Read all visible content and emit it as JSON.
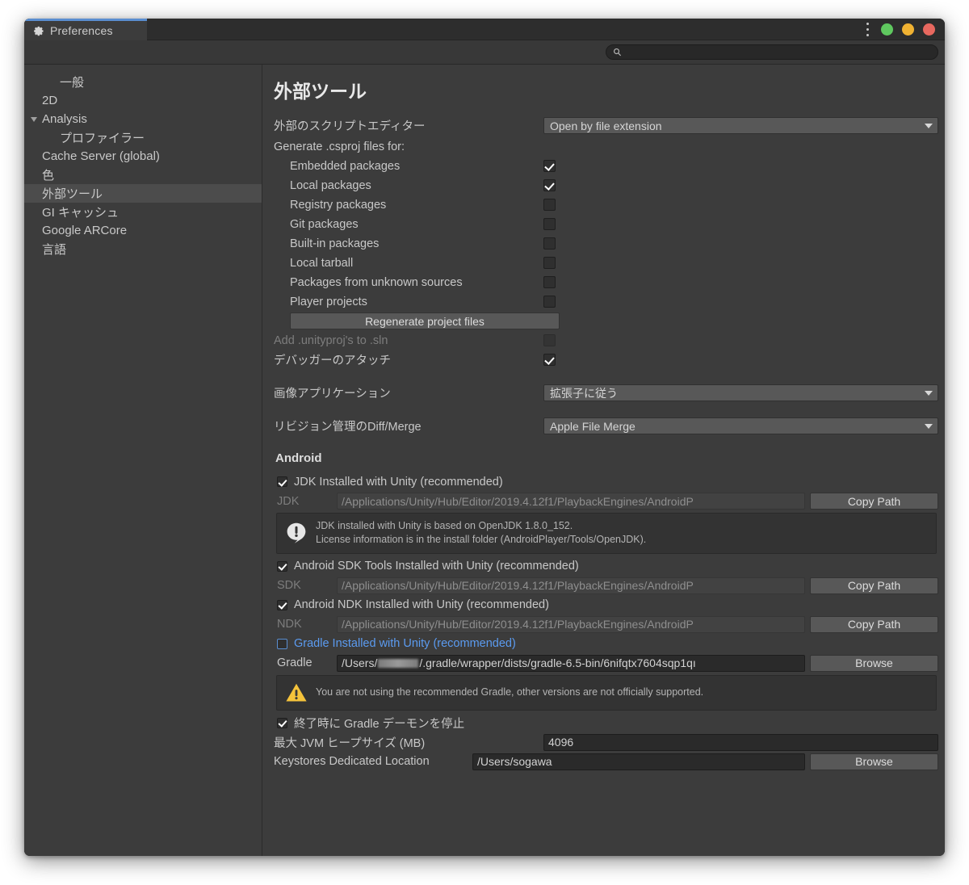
{
  "window": {
    "tab_label": "Preferences",
    "tab_icon": "gear-icon",
    "menu_icon": "kebab-menu-icon",
    "controls": [
      {
        "name": "maximize",
        "color": "#5fc85f"
      },
      {
        "name": "minimize",
        "color": "#f0b232"
      },
      {
        "name": "close",
        "color": "#e8685f"
      }
    ]
  },
  "search": {
    "value": "",
    "placeholder": "",
    "icon": "search-icon"
  },
  "sidebar": {
    "items": [
      {
        "label": "一般",
        "indent": true,
        "selected": false,
        "arrow": ""
      },
      {
        "label": "2D",
        "indent": false,
        "selected": false,
        "arrow": ""
      },
      {
        "label": "Analysis",
        "indent": false,
        "selected": false,
        "arrow": "open"
      },
      {
        "label": "プロファイラー",
        "indent": true,
        "selected": false,
        "arrow": ""
      },
      {
        "label": "Cache Server (global)",
        "indent": false,
        "selected": false,
        "arrow": ""
      },
      {
        "label": "色",
        "indent": false,
        "selected": false,
        "arrow": ""
      },
      {
        "label": "外部ツール",
        "indent": false,
        "selected": true,
        "arrow": ""
      },
      {
        "label": "GI キャッシュ",
        "indent": false,
        "selected": false,
        "arrow": ""
      },
      {
        "label": "Google ARCore",
        "indent": false,
        "selected": false,
        "arrow": ""
      },
      {
        "label": "言語",
        "indent": false,
        "selected": false,
        "arrow": ""
      }
    ]
  },
  "main": {
    "title": "外部ツール",
    "script_editor": {
      "label": "外部のスクリプトエディター",
      "value": "Open by file extension"
    },
    "csproj_label": "Generate .csproj files for:",
    "csproj_options": [
      {
        "label": "Embedded packages",
        "checked": true
      },
      {
        "label": "Local packages",
        "checked": true
      },
      {
        "label": "Registry packages",
        "checked": false
      },
      {
        "label": "Git packages",
        "checked": false
      },
      {
        "label": "Built-in packages",
        "checked": false
      },
      {
        "label": "Local tarball",
        "checked": false
      },
      {
        "label": "Packages from unknown sources",
        "checked": false
      },
      {
        "label": "Player projects",
        "checked": false
      }
    ],
    "regenerate_button": "Regenerate project files",
    "add_unityproj": {
      "label": "Add .unityproj's to .sln",
      "checked": false,
      "disabled": true
    },
    "attach_debugger": {
      "label": "デバッガーのアタッチ",
      "checked": true
    },
    "image_app": {
      "label": "画像アプリケーション",
      "value": "拡張子に従う"
    },
    "diff_merge": {
      "label": "リビジョン管理のDiff/Merge",
      "value": "Apple File Merge"
    },
    "android": {
      "heading": "Android",
      "jdk_checkbox": {
        "label": "JDK Installed with Unity (recommended)",
        "checked": true
      },
      "jdk_path": {
        "label": "JDK",
        "value": "/Applications/Unity/Hub/Editor/2019.4.12f1/PlaybackEngines/AndroidP",
        "button": "Copy Path"
      },
      "jdk_note": {
        "icon": "info-icon",
        "line1": "JDK installed with Unity is based on OpenJDK 1.8.0_152.",
        "line2": "License information is in the install folder (AndroidPlayer/Tools/OpenJDK)."
      },
      "sdk_checkbox": {
        "label": "Android SDK Tools Installed with Unity (recommended)",
        "checked": true
      },
      "sdk_path": {
        "label": "SDK",
        "value": "/Applications/Unity/Hub/Editor/2019.4.12f1/PlaybackEngines/AndroidP",
        "button": "Copy Path"
      },
      "ndk_checkbox": {
        "label": "Android NDK Installed with Unity (recommended)",
        "checked": true
      },
      "ndk_path": {
        "label": "NDK",
        "value": "/Applications/Unity/Hub/Editor/2019.4.12f1/PlaybackEngines/AndroidP",
        "button": "Copy Path"
      },
      "gradle_checkbox": {
        "label": "Gradle Installed with Unity (recommended)",
        "checked": false,
        "highlight_color": "#5b9bf0"
      },
      "gradle_path": {
        "label": "Gradle",
        "value_prefix": "/Users/",
        "value_suffix": "/.gradle/wrapper/dists/gradle-6.5-bin/6nifqtx7604sqp1qı",
        "redacted": true,
        "button": "Browse"
      },
      "gradle_warning": {
        "icon": "warning-icon",
        "text": "You are not using the recommended Gradle, other versions are not officially supported.",
        "color": "#f5c33b"
      },
      "stop_daemon": {
        "label": "終了時に Gradle デーモンを停止",
        "checked": true
      },
      "jvm_heap": {
        "label": "最大 JVM ヒープサイズ (MB)",
        "value": "4096"
      },
      "keystores": {
        "label": "Keystores Dedicated Location",
        "value": "/Users/sogawa",
        "button": "Browse"
      }
    }
  }
}
